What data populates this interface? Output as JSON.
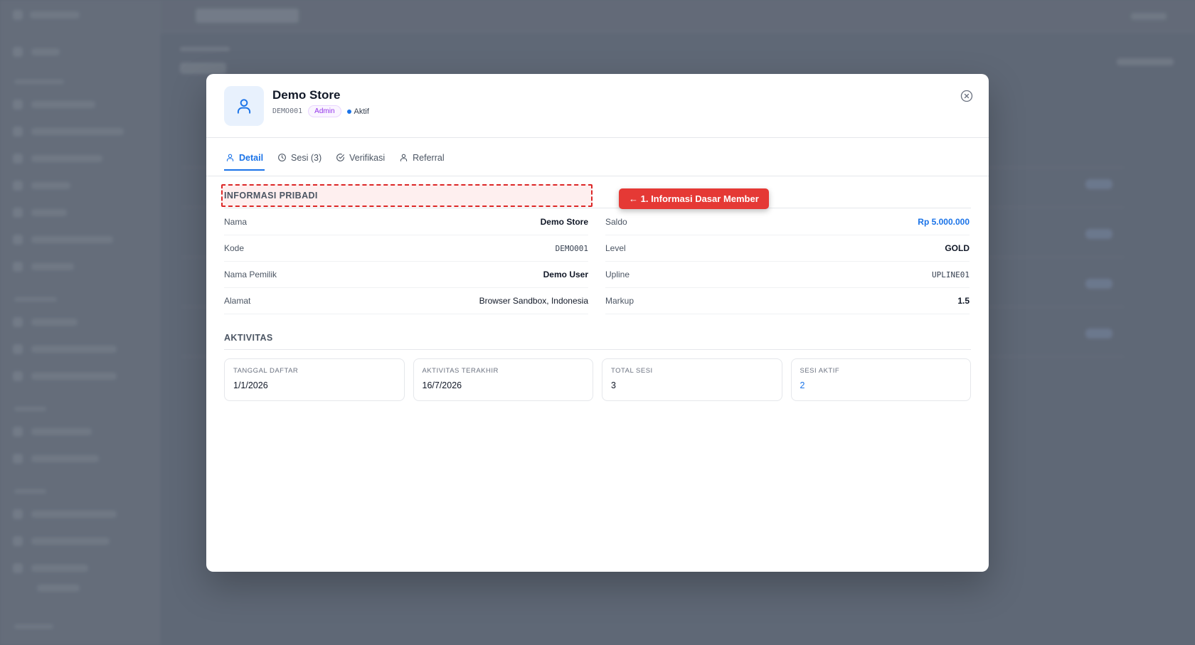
{
  "member": {
    "name": "Demo Store",
    "code": "DEMO001",
    "role_badge": "Admin",
    "status": "Aktif"
  },
  "tabs": [
    {
      "label": "Detail",
      "icon": "user-icon",
      "active": true
    },
    {
      "label": "Sesi (3)",
      "icon": "clock-icon",
      "active": false
    },
    {
      "label": "Verifikasi",
      "icon": "check-circle-icon",
      "active": false
    },
    {
      "label": "Referral",
      "icon": "user-icon",
      "active": false
    }
  ],
  "personal_info": {
    "title": "INFORMASI PRIBADI",
    "annotation": "← 1. Informasi Dasar Member",
    "left": [
      {
        "label": "Nama",
        "value": "Demo Store"
      },
      {
        "label": "Kode",
        "value": "DEMO001"
      },
      {
        "label": "Nama Pemilik",
        "value": "Demo User"
      },
      {
        "label": "Alamat",
        "value": "Browser Sandbox, Indonesia"
      }
    ],
    "right": [
      {
        "label": "Saldo",
        "value": "Rp 5.000.000"
      },
      {
        "label": "Level",
        "value": "GOLD"
      },
      {
        "label": "Upline",
        "value": "UPLINE01"
      },
      {
        "label": "Markup",
        "value": "1.5"
      }
    ]
  },
  "activity": {
    "title": "AKTIVITAS",
    "cards": [
      {
        "label": "TANGGAL DAFTAR",
        "value": "1/1/2026"
      },
      {
        "label": "AKTIVITAS TERAKHIR",
        "value": "16/7/2026"
      },
      {
        "label": "TOTAL SESI",
        "value": "3"
      },
      {
        "label": "SESI AKTIF",
        "value": "2"
      }
    ]
  },
  "colors": {
    "accent": "#1a73e8",
    "annotation": "#e53935",
    "admin_badge": "#9333ea"
  }
}
